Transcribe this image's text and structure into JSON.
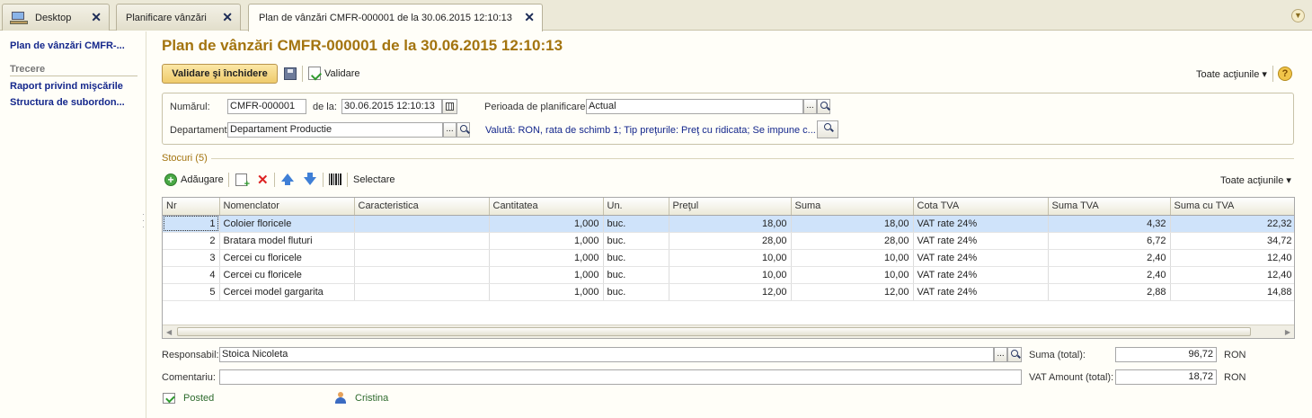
{
  "tabs": [
    {
      "label": "Desktop"
    },
    {
      "label": "Planificare vânzări"
    },
    {
      "label": "Plan de vânzări CMFR-000001 de la 30.06.2015 12:10:13"
    }
  ],
  "sidebar": {
    "main_link": "Plan de vânzări CMFR-...",
    "section": "Trecere",
    "links": [
      "Raport privind mişcările",
      "Structura de subordon..."
    ]
  },
  "page": {
    "title": "Plan de vânzări CMFR-000001 de la 30.06.2015 12:10:13"
  },
  "toolbar": {
    "primary_label": "Validare şi închidere",
    "validate_label": "Validare",
    "all_actions_label": "Toate acţiunile",
    "help_label": "?"
  },
  "header": {
    "number_label": "Numărul:",
    "number_value": "CMFR-000001",
    "date_label": "de la:",
    "date_value": "30.06.2015 12:10:13",
    "period_label": "Perioada de planificare:",
    "period_value": "Actual",
    "department_label": "Departament:",
    "department_value": "Departament Productie",
    "currency_info": "Valută: RON, rata de schimb 1; Tip preţurile: Preţ cu ridicata; Se impune c...",
    "dots": "..."
  },
  "stock": {
    "section_title": "Stocuri (5)",
    "add_label": "Adăugare",
    "select_label": "Selectare",
    "all_actions_label": "Toate acţiunile",
    "columns": [
      "Nr",
      "Nomenclator",
      "Caracteristica",
      "Cantitatea",
      "Un.",
      "Preţul",
      "Suma",
      "Cota TVA",
      "Suma TVA",
      "Suma cu TVA"
    ],
    "rows": [
      {
        "nr": "1",
        "item": "Coloier floricele",
        "characteristic": "",
        "qty": "1,000",
        "unit": "buc.",
        "price": "18,00",
        "sum": "18,00",
        "vat_rate": "VAT rate 24%",
        "vat_sum": "4,32",
        "total": "22,32"
      },
      {
        "nr": "2",
        "item": "Bratara model fluturi",
        "characteristic": "",
        "qty": "1,000",
        "unit": "buc.",
        "price": "28,00",
        "sum": "28,00",
        "vat_rate": "VAT rate 24%",
        "vat_sum": "6,72",
        "total": "34,72"
      },
      {
        "nr": "3",
        "item": "Cercei cu floricele",
        "characteristic": "",
        "qty": "1,000",
        "unit": "buc.",
        "price": "10,00",
        "sum": "10,00",
        "vat_rate": "VAT rate 24%",
        "vat_sum": "2,40",
        "total": "12,40"
      },
      {
        "nr": "4",
        "item": "Cercei cu floricele",
        "characteristic": "",
        "qty": "1,000",
        "unit": "buc.",
        "price": "10,00",
        "sum": "10,00",
        "vat_rate": "VAT rate 24%",
        "vat_sum": "2,40",
        "total": "12,40"
      },
      {
        "nr": "5",
        "item": "Cercei model gargarita",
        "characteristic": "",
        "qty": "1,000",
        "unit": "buc.",
        "price": "12,00",
        "sum": "12,00",
        "vat_rate": "VAT rate 24%",
        "vat_sum": "2,88",
        "total": "14,88"
      }
    ]
  },
  "footer": {
    "responsible_label": "Responsabil:",
    "responsible_value": "Stoica Nicoleta",
    "comment_label": "Comentariu:",
    "comment_value": "",
    "sum_total_label": "Suma (total):",
    "sum_total_value": "96,72",
    "vat_total_label": "VAT Amount (total):",
    "vat_total_value": "18,72",
    "currency": "RON",
    "status": "Posted",
    "author": "Cristina"
  },
  "colors": {
    "title": "#a3740f",
    "link": "#14278c",
    "primary_button": "#efcb6c",
    "selected_row": "#cfe3fa"
  }
}
